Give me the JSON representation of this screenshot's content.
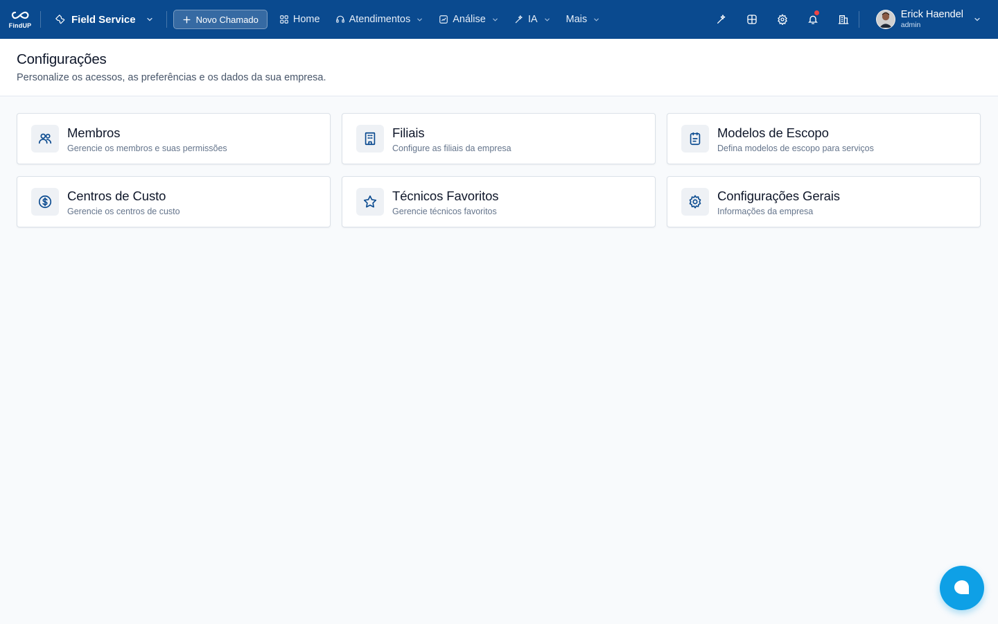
{
  "brand": {
    "logo_text": "FindUP"
  },
  "topbar": {
    "module_label": "Field Service",
    "new_button_label": "Novo Chamado",
    "nav": [
      {
        "label": "Home",
        "icon": "grid-icon"
      },
      {
        "label": "Atendimentos",
        "icon": "headset-icon"
      },
      {
        "label": "Análise",
        "icon": "chart-icon"
      },
      {
        "label": "IA",
        "icon": "sparkle-icon"
      },
      {
        "label": "Mais"
      }
    ]
  },
  "user": {
    "name": "Erick Haendel",
    "role": "admin"
  },
  "page": {
    "title": "Configurações",
    "subtitle": "Personalize os acessos, as preferências e os dados da sua empresa."
  },
  "cards": [
    {
      "title": "Membros",
      "description": "Gerencie os membros e suas permissões",
      "icon": "users-icon"
    },
    {
      "title": "Filiais",
      "description": "Configure as filiais da empresa",
      "icon": "building-icon"
    },
    {
      "title": "Modelos de Escopo",
      "description": "Defina modelos de escopo para serviços",
      "icon": "clipboard-icon"
    },
    {
      "title": "Centros de Custo",
      "description": "Gerencie os centros de custo",
      "icon": "dollar-icon"
    },
    {
      "title": "Técnicos Favoritos",
      "description": "Gerencie técnicos favoritos",
      "icon": "star-icon"
    },
    {
      "title": "Configurações Gerais",
      "description": "Informações da empresa",
      "icon": "settings-icon"
    }
  ],
  "colors": {
    "topbar": "#0a4a8f",
    "accent": "#0ea0e6",
    "notification": "#ef4444"
  }
}
